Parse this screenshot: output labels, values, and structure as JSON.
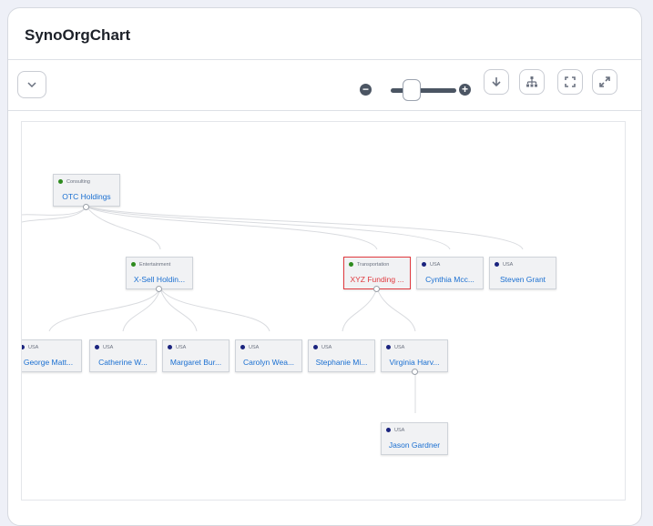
{
  "panel": {
    "title": "SynoOrgChart"
  },
  "toolbar": {
    "dropdown_icon": "chevron-down-icon",
    "zoom_out_icon": "minus-circle-icon",
    "zoom_in_icon": "plus-circle-icon",
    "zoom_level": 0.3,
    "buttons": [
      "download-icon",
      "hierarchy-icon",
      "fit-screen-icon",
      "expand-icon"
    ]
  },
  "colors": {
    "consulting": "#2e8b1e",
    "entertainment": "#2e8b1e",
    "transportation": "#2e8b1e",
    "usa": "#1a237e",
    "link": "#1a6fd1",
    "selected": "#e0393e"
  },
  "nodes": {
    "otc": {
      "category": "Consulting",
      "name": "OTC Holdings"
    },
    "xsell": {
      "category": "Entertainment",
      "name": "X-Sell Holdin..."
    },
    "xyz": {
      "category": "Transportation",
      "name": "XYZ Funding ..."
    },
    "cynthia": {
      "category": "USA",
      "name": "Cynthia Mcc..."
    },
    "steven": {
      "category": "USA",
      "name": "Steven Grant"
    },
    "george": {
      "category": "USA",
      "name": "George Matt..."
    },
    "catherine": {
      "category": "USA",
      "name": "Catherine W..."
    },
    "margaret": {
      "category": "USA",
      "name": "Margaret Bur..."
    },
    "carolyn": {
      "category": "USA",
      "name": "Carolyn Wea..."
    },
    "stephanie": {
      "category": "USA",
      "name": "Stephanie Mi..."
    },
    "virginia": {
      "category": "USA",
      "name": "Virginia Harv..."
    },
    "jason": {
      "category": "USA",
      "name": "Jason Gardner"
    }
  }
}
